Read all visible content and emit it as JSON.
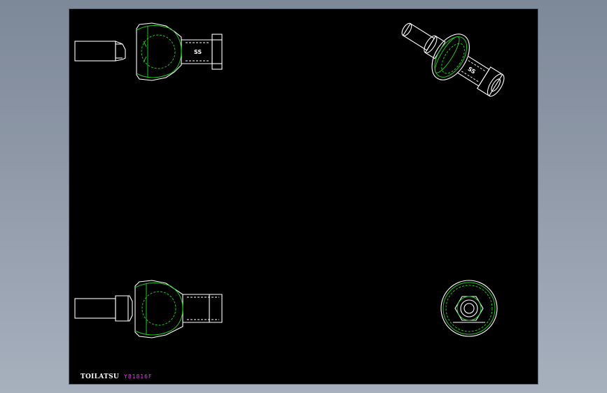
{
  "drawing": {
    "brand": "TOILATSU",
    "part_code": "Y81816F",
    "part_mark": "SS"
  },
  "colors": {
    "background": "#000000",
    "outline": "#ffffff",
    "hidden_lines": "#1fc61f",
    "code_text": "#e23ae6"
  },
  "views": [
    "front-view",
    "isometric-view",
    "bottom-view",
    "end-view"
  ]
}
